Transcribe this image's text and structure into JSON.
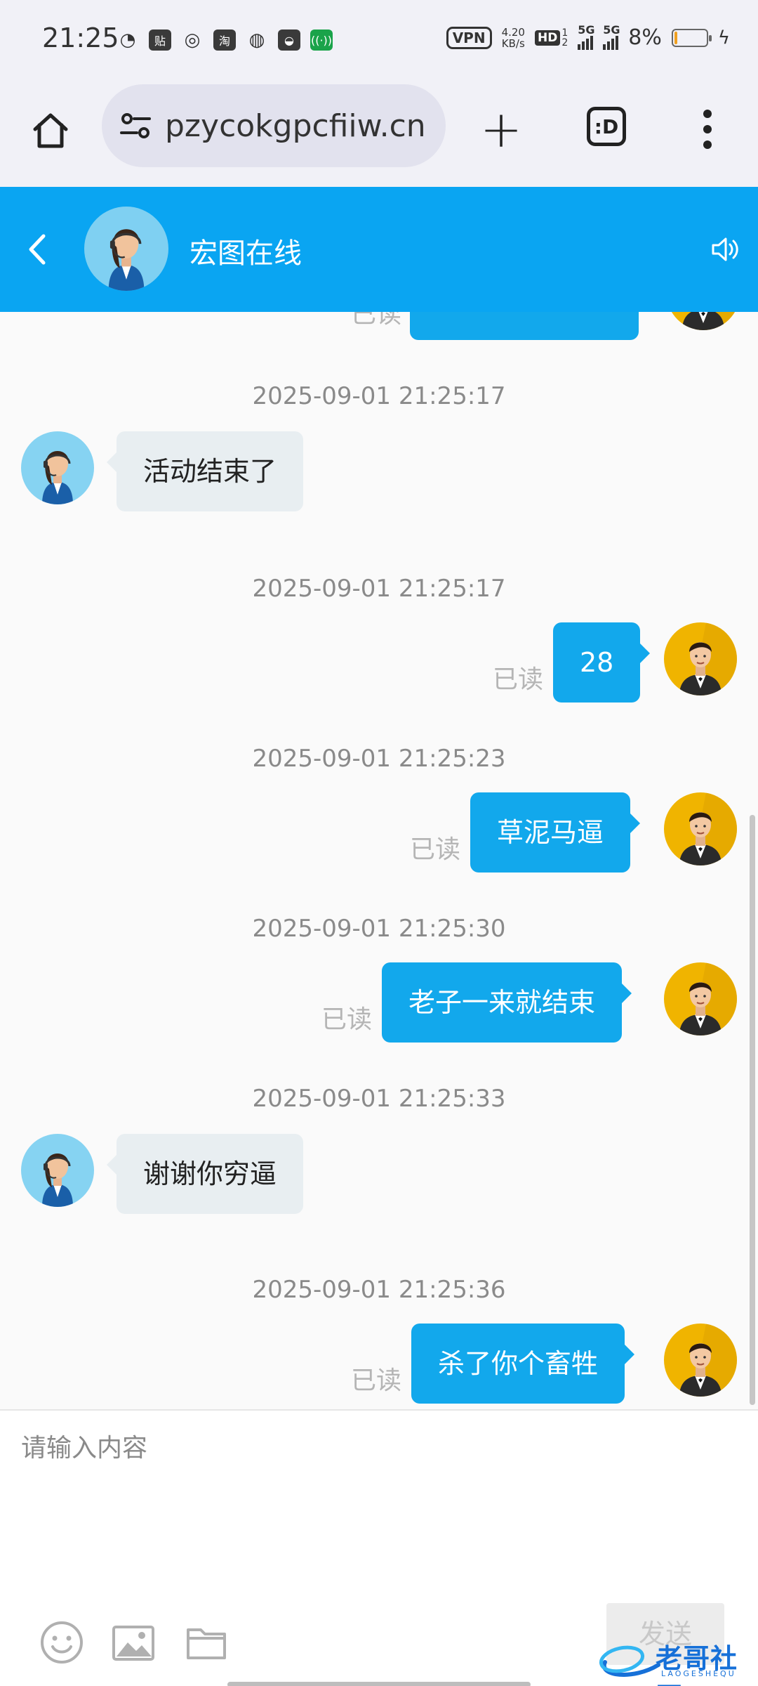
{
  "status_bar": {
    "time": "21:25",
    "icons": [
      {
        "name": "weibo-icon",
        "glyph": "◔"
      },
      {
        "name": "tieba-icon",
        "glyph": "贴"
      },
      {
        "name": "chrome-icon",
        "glyph": "◎"
      },
      {
        "name": "taobao-icon",
        "glyph": "淘"
      },
      {
        "name": "china-mobile-icon",
        "glyph": "◍"
      },
      {
        "name": "shopping-bag-icon",
        "glyph": "◒"
      },
      {
        "name": "wifi-hotspot-icon",
        "glyph": "((·))"
      }
    ],
    "vpn": "VPN",
    "net_speed_value": "4.20",
    "net_speed_unit": "KB/s",
    "hd": "HD",
    "hd_sub": "1",
    "hd_sub2": "2",
    "sig1_label": "5G",
    "sig2_label": "5G",
    "battery_pct": "8%",
    "battery_level": 0.08,
    "charging_icon": "ϟ"
  },
  "browser": {
    "url": "pzycokgpcfiiw.cn",
    "tabs_label": ":D",
    "plus_label": "+"
  },
  "chat": {
    "title": "宏图在线"
  },
  "messages": [
    {
      "timestamp": "2025-09-01 21:25:17",
      "side": "in",
      "text": "活动结束了"
    },
    {
      "timestamp": "2025-09-01 21:25:17",
      "side": "out",
      "text": "28",
      "read": "已读"
    },
    {
      "timestamp": "2025-09-01 21:25:23",
      "side": "out",
      "text": "草泥马逼",
      "read": "已读"
    },
    {
      "timestamp": "2025-09-01 21:25:30",
      "side": "out",
      "text": "老子一来就结束",
      "read": "已读"
    },
    {
      "timestamp": "2025-09-01 21:25:33",
      "side": "in",
      "text": "谢谢你穷逼"
    },
    {
      "timestamp": "2025-09-01 21:25:36",
      "side": "out",
      "text": "杀了你个畜牲",
      "read": "已读"
    }
  ],
  "partial_top": {
    "read": "已读"
  },
  "composer": {
    "placeholder": "请输入内容",
    "send_label": "发送"
  },
  "watermark": {
    "text": "老哥社区",
    "subtext": "LAOGESHEQU"
  },
  "colors": {
    "accent": "#0aa5f2",
    "bubble_out": "#12a8ec",
    "bubble_in": "#e8eef1",
    "user_avatar_bg": "#f0b400",
    "agent_avatar_bg": "#86d3f2"
  }
}
